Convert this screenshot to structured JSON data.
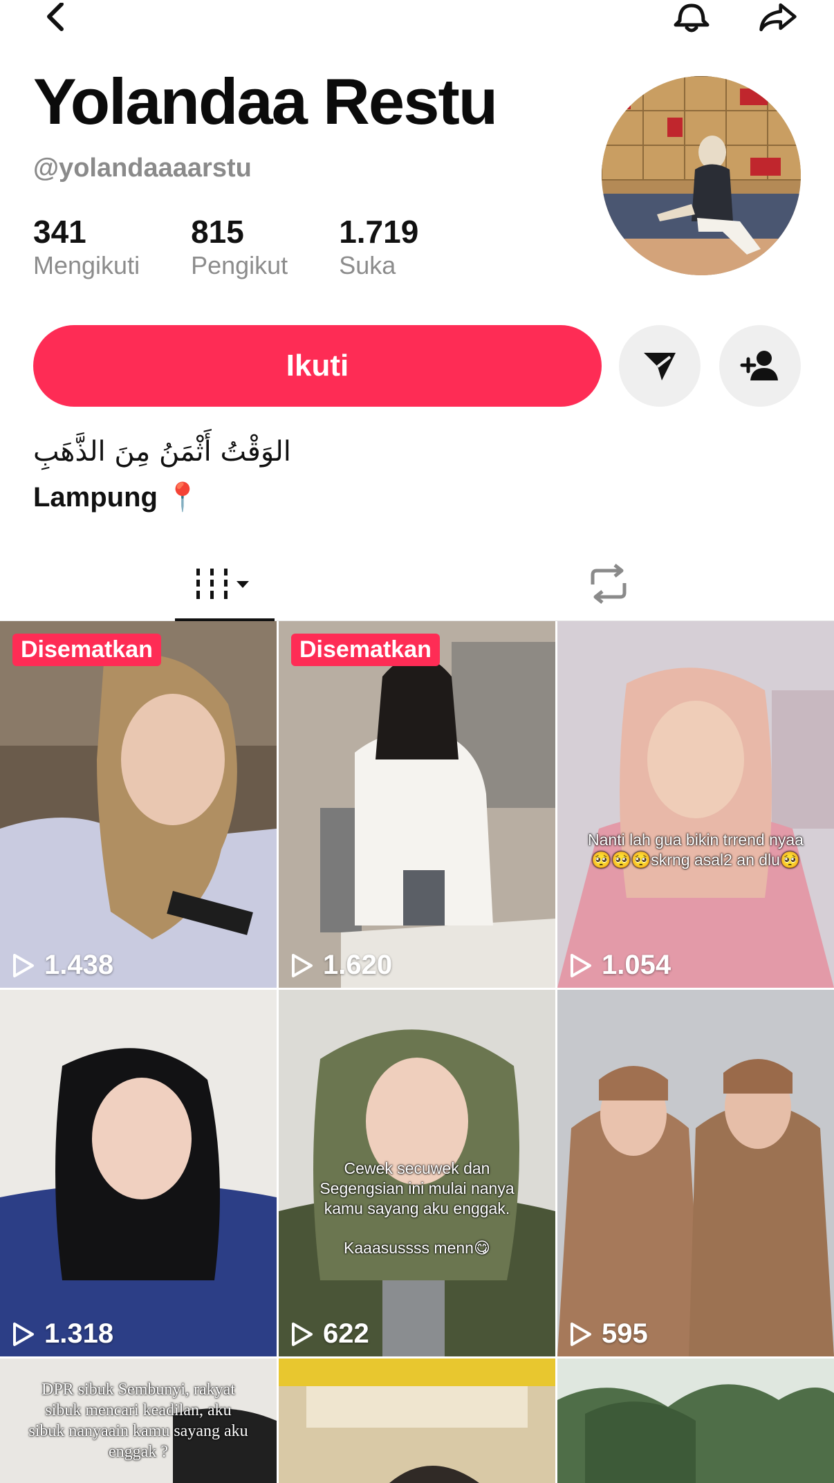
{
  "profile": {
    "name": "Yolandaa Restu",
    "handle": "@yolandaaaarstu",
    "stats": [
      {
        "value": "341",
        "label": "Mengikuti"
      },
      {
        "value": "815",
        "label": "Pengikut"
      },
      {
        "value": "1.719",
        "label": "Suka"
      }
    ],
    "follow_label": "Ikuti",
    "bio_line1": "الوَقْتُ أَثْمَنُ مِنَ الذَّهَبِ",
    "bio_line2": "Lampung 📍"
  },
  "icons": [
    "chevron-left-icon",
    "bell-icon",
    "share-icon",
    "send-icon",
    "add-friend-icon",
    "grid-videos-icon",
    "caret-down-icon",
    "repost-icon",
    "play-icon"
  ],
  "colors": {
    "accent": "#fe2c55",
    "muted": "#8a8a8a"
  },
  "videos": [
    {
      "pinned": "Disematkan",
      "views": "1.438",
      "caption": ""
    },
    {
      "pinned": "Disematkan",
      "views": "1.620",
      "caption": ""
    },
    {
      "pinned": "",
      "views": "1.054",
      "caption": "Nanti lah gua bikin trrend nyaa 🥺🥺🥺skrng asal2 an dlu🥺"
    },
    {
      "pinned": "",
      "views": "1.318",
      "caption": ""
    },
    {
      "pinned": "",
      "views": "622",
      "caption": "Cewek secuwek dan Segengsian ini mulai nanya kamu sayang aku enggak.\n\nKaaasussss menn😋"
    },
    {
      "pinned": "",
      "views": "595",
      "caption": ""
    },
    {
      "pinned": "",
      "views": "",
      "caption": "DPR sibuk Sembunyi, rakyat sibuk mencari keadilan, aku sibuk nanyaain kamu sayang aku enggak ?"
    },
    {
      "pinned": "",
      "views": "",
      "caption": ""
    },
    {
      "pinned": "",
      "views": "",
      "caption": ""
    }
  ]
}
